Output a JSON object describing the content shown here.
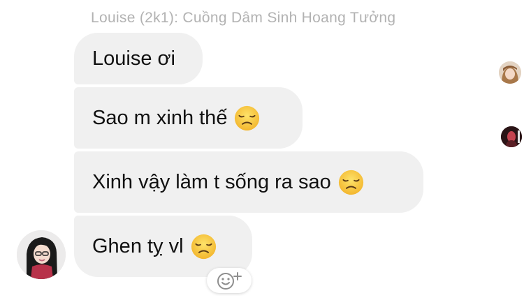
{
  "sender": {
    "name": "Louise (2k1): Cuồng Dâm Sinh Hoang Tưởng"
  },
  "messages": [
    {
      "text": "Louise ơi",
      "emoji": ""
    },
    {
      "text": "Sao m xinh thế",
      "emoji": "disappointed-face"
    },
    {
      "text": "Xinh vậy làm t sống ra sao",
      "emoji": "disappointed-face"
    },
    {
      "text": "Ghen tỵ vl",
      "emoji": "disappointed-face"
    }
  ],
  "icons": {
    "reaction": "add-reaction-icon",
    "emoji": "disappointed-face-icon"
  },
  "colors": {
    "bubble_bg": "#f0f0f0",
    "sender_name": "#b2b2b2",
    "text": "#111111",
    "emoji_yellow": "#f7c23c"
  }
}
